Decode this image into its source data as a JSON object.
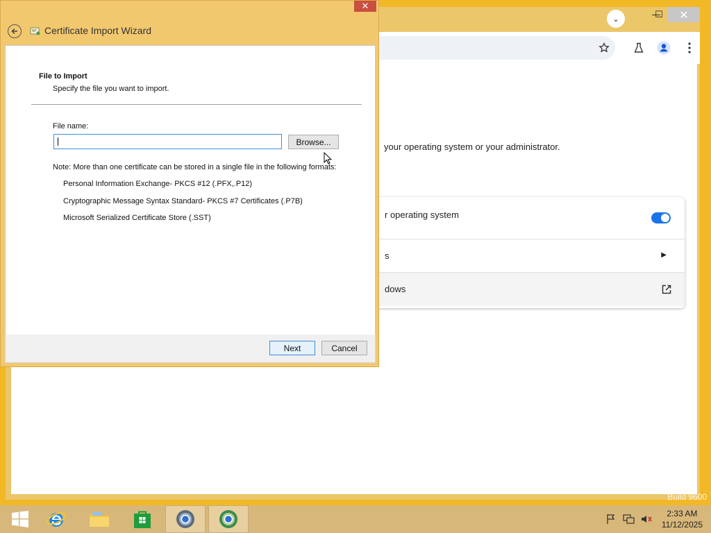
{
  "wizard": {
    "title": "Certificate Import Wizard",
    "close_glyph": "✕",
    "section_title": "File to Import",
    "section_subtitle": "Specify the file you want to import.",
    "file_name_label": "File name:",
    "file_name_value": "",
    "browse_label": "Browse...",
    "note": "Note:  More than one certificate can be stored in a single file in the following formats:",
    "formats": [
      "Personal Information Exchange- PKCS #12 (.PFX,.P12)",
      "Cryptographic Message Syntax Standard- PKCS #7 Certificates (.P7B)",
      "Microsoft Serialized Certificate Store (.SST)"
    ],
    "next_label": "Next",
    "cancel_label": "Cancel"
  },
  "chrome": {
    "tab_search_glyph": "⌄",
    "minimize_glyph": "—",
    "maximize_glyph": "☐",
    "close_glyph": "✕",
    "description_partial": "your operating system or your administrator.",
    "rows": [
      {
        "label": "r operating system",
        "control": "toggle",
        "enabled": true
      },
      {
        "label": "s",
        "control": "arrow"
      },
      {
        "label": "dows",
        "control": "external-link"
      }
    ]
  },
  "taskbar": {
    "time": "2:33 AM",
    "date": "11/12/2025"
  },
  "watermark": "Build 9600",
  "colors": {
    "desktop": "#f2b826",
    "wizard_frame": "#f2c86f",
    "toggle_on": "#1a73e8",
    "wizard_close": "#c94f3e"
  }
}
